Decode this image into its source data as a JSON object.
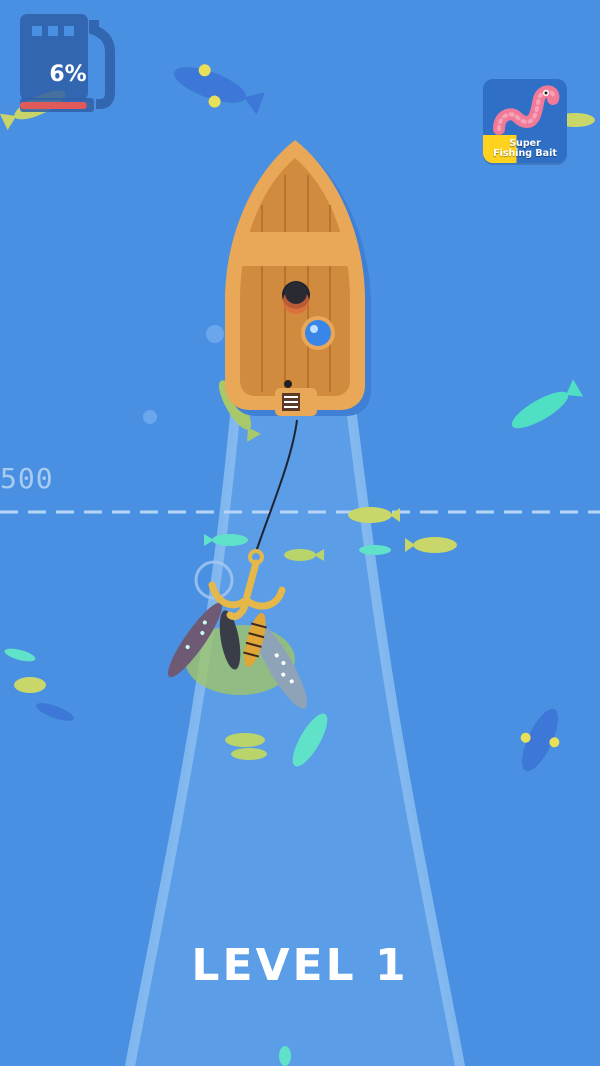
{
  "hud": {
    "fuel_percent": "6%",
    "fuel_level": 0.06,
    "fuel_icon": "fuel-pump-icon"
  },
  "powerup": {
    "title_line1": "Super",
    "title_line2": "Fishing Bait",
    "icon": "worm-icon",
    "progress": 0.4
  },
  "depth_marker": "500",
  "level": "LEVEL 1",
  "colors": {
    "water": "#4a90e2",
    "wake": "#7fb4ee",
    "boat_wood": "#e8a857",
    "hook": "#e6b84a",
    "accent_yellow": "#ffd21f"
  }
}
